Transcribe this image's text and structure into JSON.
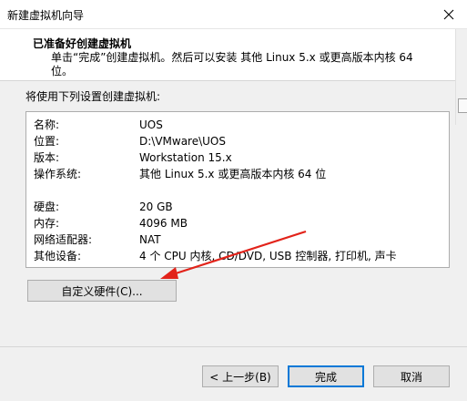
{
  "window": {
    "title": "新建虚拟机向导"
  },
  "header": {
    "title": "已准备好创建虚拟机",
    "description": "单击“完成”创建虚拟机。然后可以安装 其他 Linux 5.x 或更高版本内核 64 位。"
  },
  "intro": "将使用下列设置创建虚拟机:",
  "settings": [
    {
      "key": "名称:",
      "value": "UOS"
    },
    {
      "key": "位置:",
      "value": "D:\\VMware\\UOS"
    },
    {
      "key": "版本:",
      "value": "Workstation 15.x"
    },
    {
      "key": "操作系统:",
      "value": "其他 Linux 5.x 或更高版本内核 64 位"
    },
    {
      "key": "硬盘:",
      "value": "20 GB"
    },
    {
      "key": "内存:",
      "value": "4096 MB"
    },
    {
      "key": "网络适配器:",
      "value": "NAT"
    },
    {
      "key": "其他设备:",
      "value": "4 个 CPU 内核, CD/DVD, USB 控制器, 打印机, 声卡"
    }
  ],
  "buttons": {
    "customize": "自定义硬件(C)...",
    "back": "< 上一步(B)",
    "finish": "完成",
    "cancel": "取消"
  },
  "colors": {
    "accent": "#0078d7",
    "annotation_arrow": "#e2231a"
  }
}
